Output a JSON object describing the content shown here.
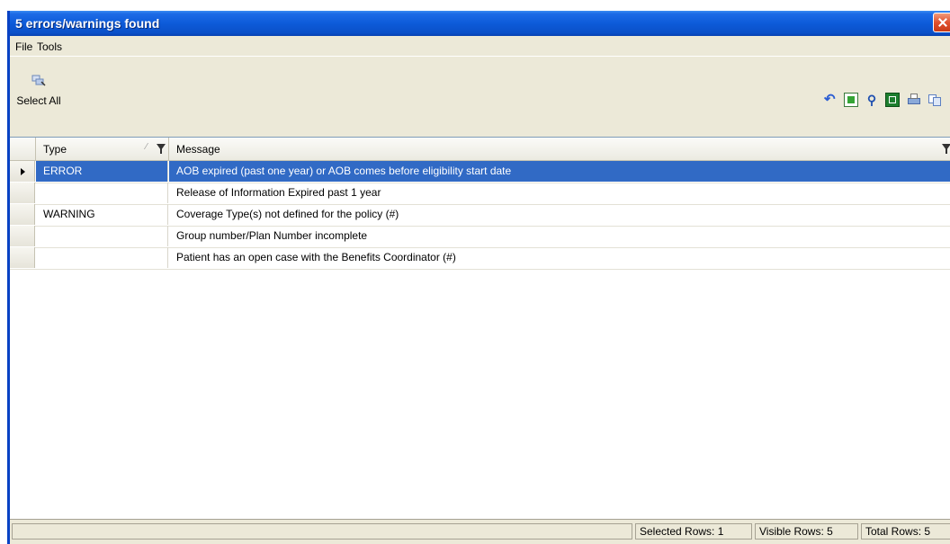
{
  "window": {
    "title": "5 errors/warnings found"
  },
  "menu": {
    "file": "File",
    "tools": "Tools"
  },
  "toolbar": {
    "select_all_label": "Select All",
    "icons": [
      "undo-icon",
      "refresh-icon",
      "find-icon",
      "excel-export-icon",
      "print-icon",
      "copy-icon"
    ]
  },
  "grid": {
    "columns": {
      "type": "Type",
      "message": "Message"
    },
    "rows": [
      {
        "type": "ERROR",
        "message": "AOB expired (past one year) or AOB comes before eligibility start date",
        "selected": true
      },
      {
        "type": "",
        "message": "Release of Information Expired past 1 year",
        "selected": false
      },
      {
        "type": "WARNING",
        "message": "Coverage Type(s) not defined for the policy (#)",
        "selected": false
      },
      {
        "type": "",
        "message": "Group number/Plan Number incomplete",
        "selected": false
      },
      {
        "type": "",
        "message": "Patient has an open case with the Benefits Coordinator (#)",
        "selected": false
      }
    ]
  },
  "status": {
    "selected_rows": "Selected Rows: 1",
    "visible_rows": "Visible Rows: 5",
    "total_rows": "Total Rows: 5"
  },
  "colors": {
    "titlebar": "#0A50C8",
    "selection": "#316AC5",
    "chrome": "#ECE9D8"
  }
}
